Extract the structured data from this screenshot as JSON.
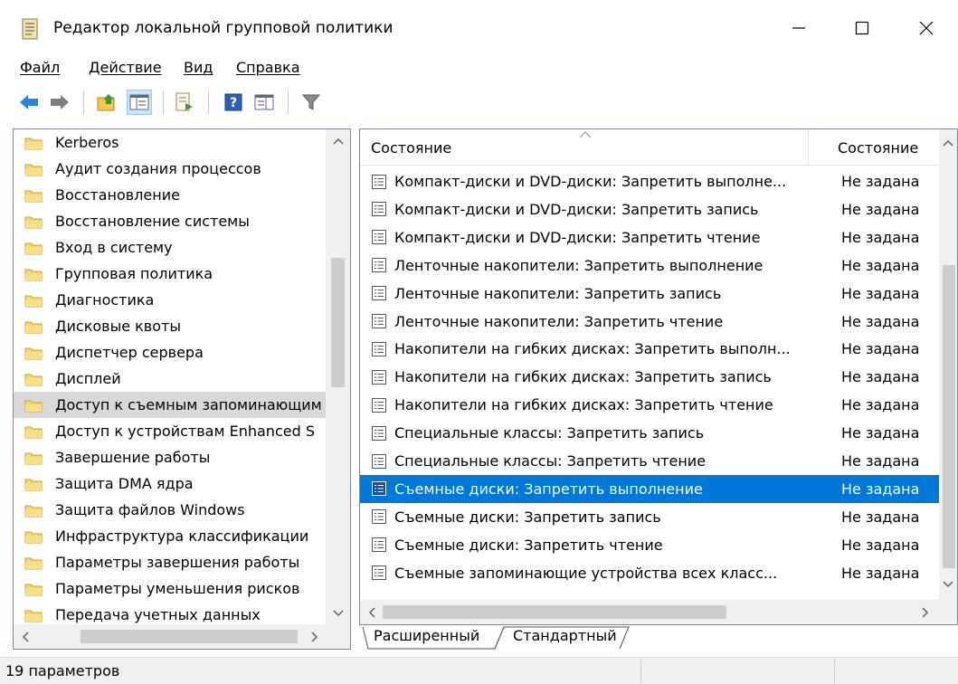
{
  "window": {
    "title": "Редактор локальной групповой политики",
    "minimize_glyph": "—",
    "maximize_glyph": "☐",
    "close_glyph": "✕"
  },
  "menu": {
    "items": [
      "Файл",
      "Действие",
      "Вид",
      "Справка"
    ]
  },
  "toolbar": {
    "icons": [
      "back-arrow-icon",
      "forward-arrow-icon",
      "up-folder-icon",
      "show-hide-tree-icon",
      "export-list-icon",
      "help-icon",
      "extended-view-icon",
      "filter-icon"
    ]
  },
  "tree": {
    "items": [
      "Kerberos",
      "Аудит создания процессов",
      "Восстановление",
      "Восстановление системы",
      "Вход в систему",
      "Групповая политика",
      "Диагностика",
      "Дисковые квоты",
      "Диспетчер сервера",
      "Дисплей",
      "Доступ к съемным запоминающим",
      "Доступ к устройствам Enhanced S",
      "Завершение работы",
      "Защита DMA ядра",
      "Защита файлов Windows",
      "Инфраструктура классификации",
      "Параметры завершения работы",
      "Параметры уменьшения рисков",
      "Передача учетных данных"
    ],
    "selected_index": 10
  },
  "list": {
    "columns": [
      "Состояние",
      "Состояние"
    ],
    "rows": [
      {
        "name": "Компакт-диски и DVD-диски: Запретить выполне...",
        "state": "Не задана"
      },
      {
        "name": "Компакт-диски и DVD-диски: Запретить запись",
        "state": "Не задана"
      },
      {
        "name": "Компакт-диски и DVD-диски: Запретить чтение",
        "state": "Не задана"
      },
      {
        "name": "Ленточные накопители: Запретить выполнение",
        "state": "Не задана"
      },
      {
        "name": "Ленточные накопители: Запретить запись",
        "state": "Не задана"
      },
      {
        "name": "Ленточные накопители: Запретить чтение",
        "state": "Не задана"
      },
      {
        "name": "Накопители на гибких дисках: Запретить выполн...",
        "state": "Не задана"
      },
      {
        "name": "Накопители на гибких дисках: Запретить запись",
        "state": "Не задана"
      },
      {
        "name": "Накопители на гибких дисках: Запретить чтение",
        "state": "Не задана"
      },
      {
        "name": "Специальные классы: Запретить запись",
        "state": "Не задана"
      },
      {
        "name": "Специальные классы: Запретить чтение",
        "state": "Не задана"
      },
      {
        "name": "Съемные диски: Запретить выполнение",
        "state": "Не задана"
      },
      {
        "name": "Съемные диски: Запретить запись",
        "state": "Не задана"
      },
      {
        "name": "Съемные диски: Запретить чтение",
        "state": "Не задана"
      },
      {
        "name": "Съемные запоминающие устройства всех класс...",
        "state": "Не задана"
      }
    ],
    "selected_index": 11
  },
  "tabs": [
    "Расширенный",
    "Стандартный"
  ],
  "status": {
    "text": "19 параметров"
  },
  "colors": {
    "selection": "#0078d7",
    "tree_selection": "#d9d9d9",
    "folder": "#f7d674"
  }
}
